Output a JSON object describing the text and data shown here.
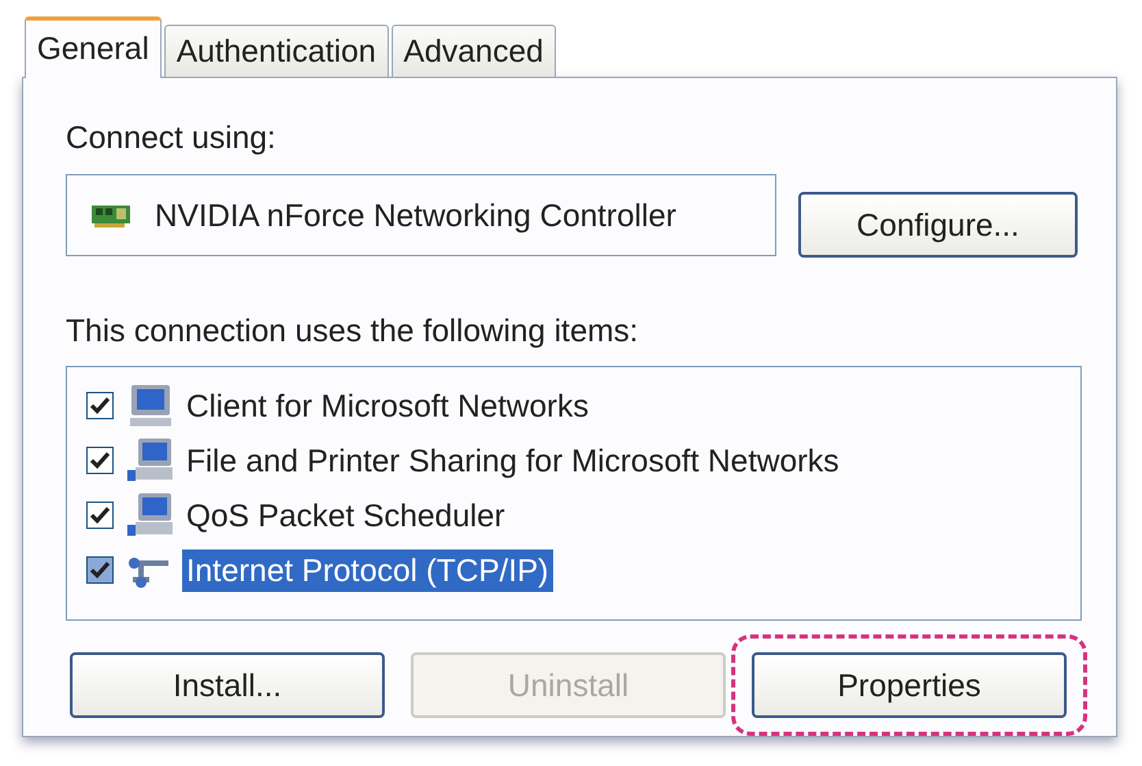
{
  "tabs": [
    {
      "label": "General",
      "selected": true
    },
    {
      "label": "Authentication",
      "selected": false
    },
    {
      "label": "Advanced",
      "selected": false
    }
  ],
  "connect_using": {
    "label": "Connect using:",
    "adapter": "NVIDIA nForce Networking Controller",
    "button": "Configure..."
  },
  "items_label": "This connection uses the following items:",
  "items": [
    {
      "kind": "client",
      "label": "Client for Microsoft Networks",
      "checked": true,
      "selected": false
    },
    {
      "kind": "service",
      "label": "File and Printer Sharing for Microsoft Networks",
      "checked": true,
      "selected": false
    },
    {
      "kind": "service",
      "label": "QoS Packet Scheduler",
      "checked": true,
      "selected": false
    },
    {
      "kind": "protocol",
      "label": "Internet Protocol (TCP/IP)",
      "checked": true,
      "selected": true
    }
  ],
  "buttons": [
    {
      "label": "Install...",
      "disabled": false,
      "highlighted": false
    },
    {
      "label": "Uninstall",
      "disabled": true,
      "highlighted": false
    },
    {
      "label": "Properties",
      "disabled": false,
      "highlighted": true
    }
  ]
}
